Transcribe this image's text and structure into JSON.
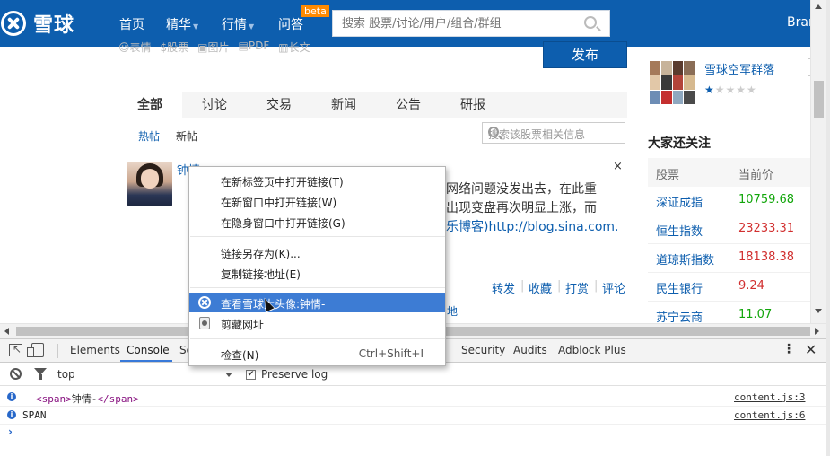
{
  "site": {
    "logo_text": "雪球"
  },
  "nav": {
    "items": [
      {
        "label": "首页",
        "caret": ""
      },
      {
        "label": "精华",
        "caret": "▼"
      },
      {
        "label": "行情",
        "caret": "▼"
      },
      {
        "label": "问答",
        "caret": ""
      }
    ],
    "beta_badge": "beta",
    "search_placeholder": "搜索 股票/讨论/用户/组合/群组",
    "user_label": "Bran"
  },
  "composer": {
    "tools": [
      "☺表情",
      "$股票",
      "▣图片",
      "▤PDF",
      "▥长文"
    ],
    "publish_label": "发布"
  },
  "feed": {
    "tabs": [
      "全部",
      "讨论",
      "交易",
      "新闻",
      "公告",
      "研报"
    ],
    "subtabs": [
      "热帖",
      "新帖"
    ],
    "stock_search_placeholder": "搜索该股票相关信息",
    "post": {
      "author": "钟情-",
      "close": "×",
      "lines": [
        {
          "text": "网络问题没发出去，在此重",
          "link": ""
        },
        {
          "text": "出现变盘再次明显上涨，而",
          "link": ""
        },
        {
          "text": "乐博客)",
          "link": "http://blog.sina.com."
        }
      ],
      "actions": [
        "转发",
        "收藏",
        "打赏",
        "评论"
      ],
      "next_post_partial": "地"
    }
  },
  "sidebar": {
    "group_name": "雪球空军群落",
    "stars": {
      "filled": "★",
      "empty": "★★★★"
    },
    "follow_title": "大家还关注",
    "stock_headers": [
      "股票",
      "当前价"
    ],
    "stocks": [
      {
        "name": "深证成指",
        "price": "10759.68",
        "trend": "up"
      },
      {
        "name": "恒生指数",
        "price": "23233.31",
        "trend": "down"
      },
      {
        "name": "道琼斯指数",
        "price": "18138.38",
        "trend": "down"
      },
      {
        "name": "民生银行",
        "price": "9.24",
        "trend": "down"
      },
      {
        "name": "苏宁云商",
        "price": "11.07",
        "trend": "up"
      }
    ]
  },
  "context_menu": {
    "items": [
      {
        "label": "在新标签页中打开链接(T)",
        "shortcut": ""
      },
      {
        "label": "在新窗口中打开链接(W)",
        "shortcut": ""
      },
      {
        "label": "在隐身窗口中打开链接(G)",
        "shortcut": ""
      },
      {
        "label": "链接另存为(K)...",
        "shortcut": ""
      },
      {
        "label": "复制链接地址(E)",
        "shortcut": ""
      },
      {
        "label": "查看雪球大头像:钟情-",
        "shortcut": ""
      },
      {
        "label": "剪藏网址",
        "shortcut": ""
      },
      {
        "label": "检查(N)",
        "shortcut": "Ctrl+Shift+I"
      }
    ]
  },
  "devtools": {
    "tabs": [
      "Elements",
      "Console",
      "So",
      "Security",
      "Audits",
      "Adblock Plus"
    ],
    "active_tab": "Console",
    "context": "top",
    "preserve_log": "Preserve log",
    "logs": [
      {
        "open_tag": "<span>",
        "content": "钟情-",
        "close_tag": "</span>",
        "source": "content.js:3"
      },
      {
        "open_tag": "",
        "content": "SPAN",
        "close_tag": "",
        "source": "content.js:6"
      }
    ],
    "prompt": "›"
  },
  "colors": {
    "brand": "#0d5eae",
    "highlight": "#3d7cd4",
    "up": "#12a60b",
    "down": "#d12f2f"
  }
}
